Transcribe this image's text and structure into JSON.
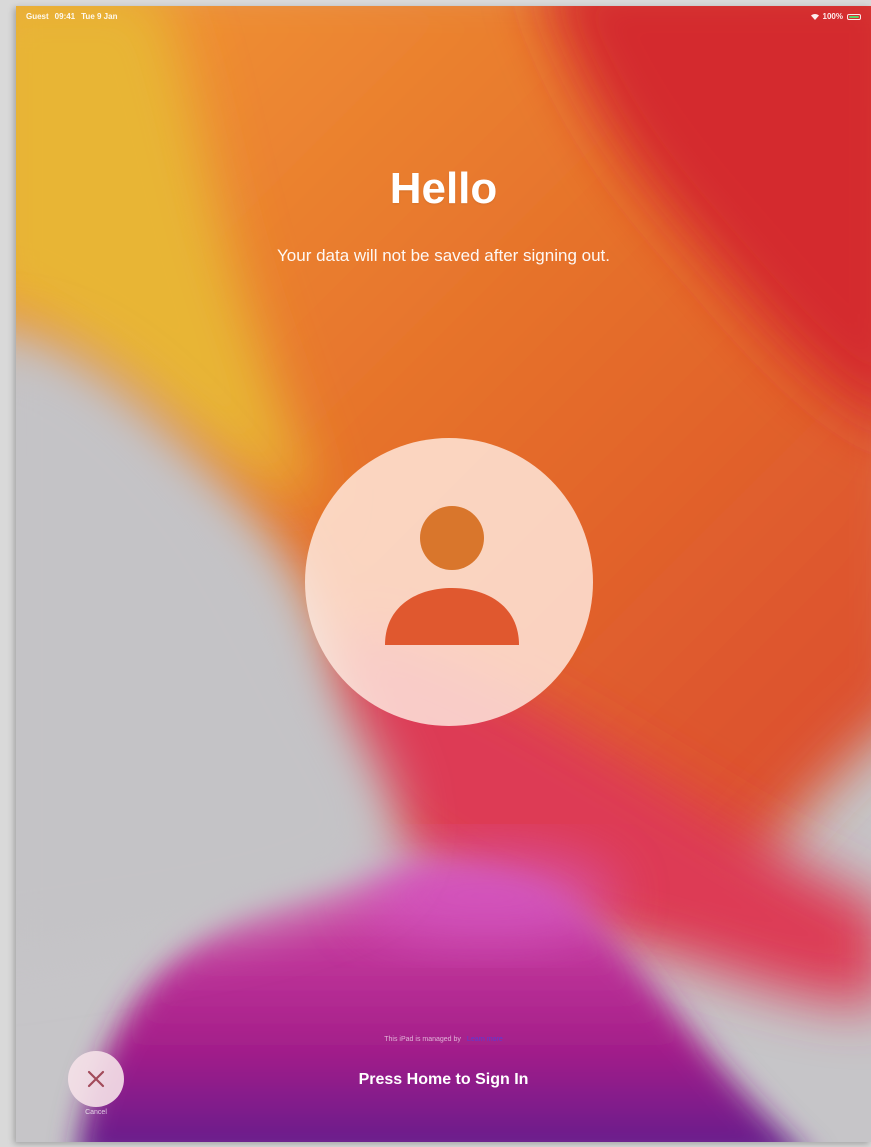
{
  "status_bar": {
    "carrier": "Guest",
    "time": "09:41",
    "date": "Tue 9 Jan",
    "battery": "100%",
    "wifi_icon": "wifi-icon",
    "battery_icon": "battery-icon"
  },
  "main": {
    "title": "Hello",
    "subtitle": "Your data will not be saved after signing out.",
    "avatar_icon": "person-icon"
  },
  "footer": {
    "managed_note": "This iPad is managed by",
    "learn_more": "Learn more",
    "signin_hint": "Press Home to Sign In",
    "cancel_icon": "close-icon",
    "cancel_label": "Cancel"
  },
  "colors": {
    "accent_orange": "#e2702a",
    "accent_red": "#d9363a",
    "accent_magenta": "#b5198c",
    "link": "#5b3bd6"
  }
}
